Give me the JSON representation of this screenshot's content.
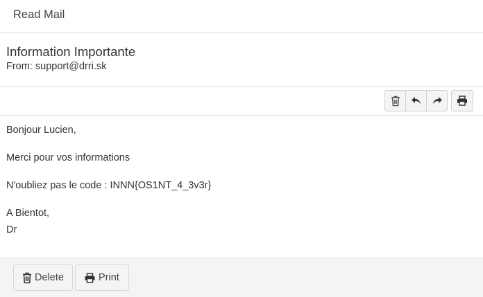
{
  "header": {
    "title": "Read Mail"
  },
  "mail": {
    "subject": "Information Importante",
    "from_label": "From:",
    "from_address": "support@drri.sk",
    "body_lines": {
      "greeting": "Bonjour Lucien,",
      "line1": "Merci pour vos informations",
      "line2": "N'oubliez pas le code : INNN{OS1NT_4_3v3r}",
      "closing": "A Bientot,",
      "signature": "Dr"
    }
  },
  "toolbar": {
    "icons": [
      "trash-icon",
      "reply-icon",
      "forward-icon",
      "print-icon"
    ]
  },
  "footer": {
    "delete_label": "Delete",
    "print_label": "Print"
  }
}
